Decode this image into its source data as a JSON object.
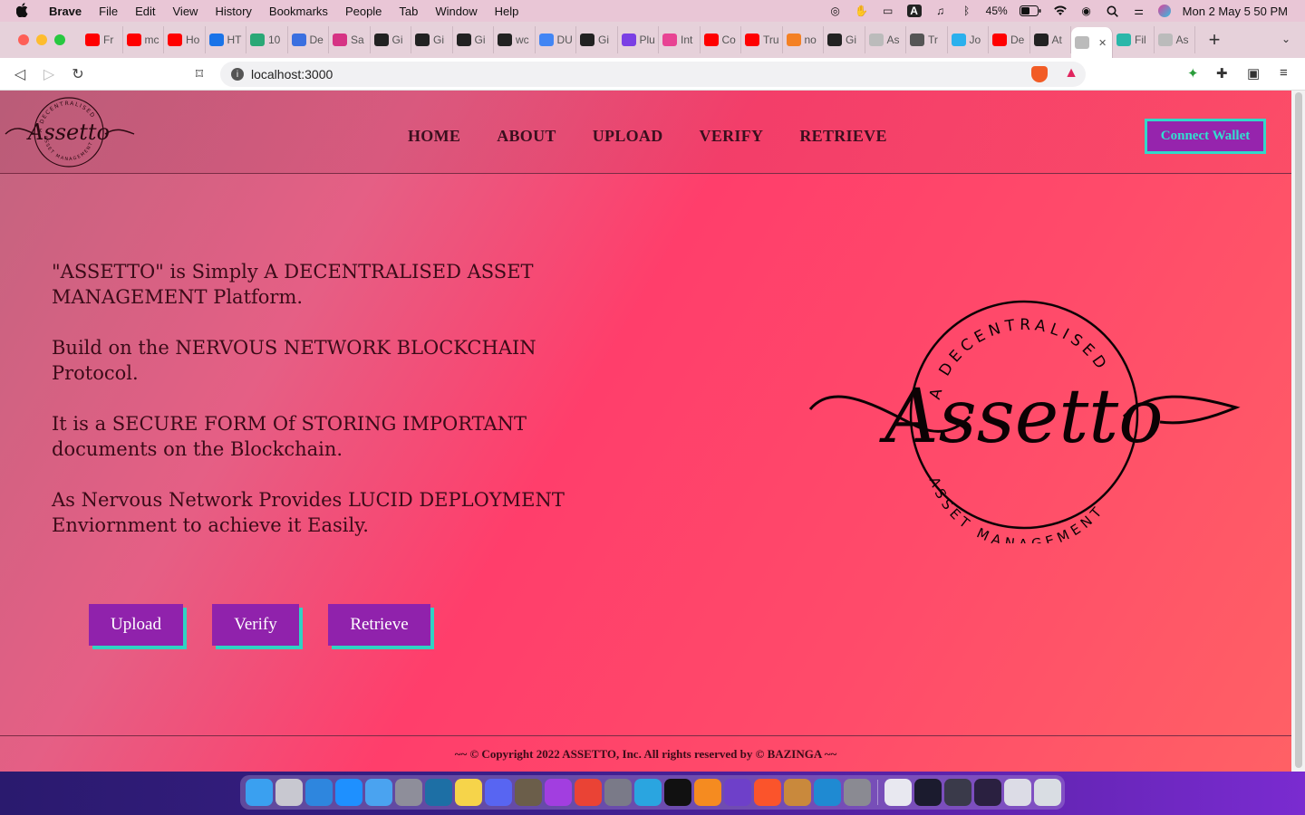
{
  "menubar": {
    "app_name": "Brave",
    "items": [
      "File",
      "Edit",
      "View",
      "History",
      "Bookmarks",
      "People",
      "Tab",
      "Window",
      "Help"
    ],
    "battery": "45%",
    "clock": "Mon 2 May  5 50 PM"
  },
  "tabs": [
    {
      "label": "Fr",
      "color": "#ff0000",
      "icon": "youtube-icon"
    },
    {
      "label": "mc",
      "color": "#ff0000",
      "icon": "youtube-icon"
    },
    {
      "label": "Ho",
      "color": "#ff0000",
      "icon": "youtube-icon"
    },
    {
      "label": "HT",
      "color": "#1a73e8",
      "icon": "site-icon"
    },
    {
      "label": "10",
      "color": "#2aa876",
      "icon": "site-icon"
    },
    {
      "label": "De",
      "color": "#3b6fe0",
      "icon": "site-icon"
    },
    {
      "label": "Sa",
      "color": "#d63384",
      "icon": "site-icon"
    },
    {
      "label": "Gi",
      "color": "#222222",
      "icon": "github-icon"
    },
    {
      "label": "Gi",
      "color": "#222222",
      "icon": "github-icon"
    },
    {
      "label": "Gi",
      "color": "#222222",
      "icon": "github-icon"
    },
    {
      "label": "wc",
      "color": "#222222",
      "icon": "github-icon"
    },
    {
      "label": "DU",
      "color": "#4285f4",
      "icon": "docs-icon"
    },
    {
      "label": "Gi",
      "color": "#222222",
      "icon": "github-icon"
    },
    {
      "label": "Plu",
      "color": "#7b3fe4",
      "icon": "site-icon"
    },
    {
      "label": "Int",
      "color": "#e84393",
      "icon": "site-icon"
    },
    {
      "label": "Co",
      "color": "#ff0000",
      "icon": "youtube-icon"
    },
    {
      "label": "Tru",
      "color": "#ff0000",
      "icon": "youtube-icon"
    },
    {
      "label": "no",
      "color": "#f48024",
      "icon": "stackoverflow-icon"
    },
    {
      "label": "Gi",
      "color": "#222222",
      "icon": "github-icon"
    },
    {
      "label": "As",
      "color": "#bbbbbb",
      "icon": "site-icon"
    },
    {
      "label": "Tr",
      "color": "#555555",
      "icon": "site-icon"
    },
    {
      "label": "Jo",
      "color": "#2bb0ed",
      "icon": "site-icon"
    },
    {
      "label": "De",
      "color": "#ff0000",
      "icon": "youtube-icon"
    },
    {
      "label": "At",
      "color": "#222222",
      "icon": "github-icon"
    },
    {
      "label": "",
      "color": "#bbbbbb",
      "icon": "site-icon",
      "active": true
    },
    {
      "label": "Fil",
      "color": "#2ab7a9",
      "icon": "site-icon"
    },
    {
      "label": "As",
      "color": "#bbbbbb",
      "icon": "site-icon"
    }
  ],
  "toolbar": {
    "url": "localhost:3000"
  },
  "site": {
    "nav": [
      "HOME",
      "ABOUT",
      "UPLOAD",
      "VERIFY",
      "RETRIEVE"
    ],
    "connect_label": "Connect Wallet",
    "logo": {
      "script": "Assetto",
      "top_arc": "A DECENTRALISED",
      "bottom_arc": "ASSET MANAGEMENT"
    },
    "paragraphs": [
      "\"ASSETTO\" is Simply A DECENTRALISED ASSET MANAGEMENT Platform.",
      "Build on the NERVOUS NETWORK BLOCKCHAIN Protocol.",
      "It is a SECURE FORM Of STORING IMPORTANT documents on the Blockchain.",
      "As Nervous Network Provides LUCID DEPLOYMENT Enviornment to achieve it Easily."
    ],
    "buttons": {
      "upload": "Upload",
      "verify": "Verify",
      "retrieve": "Retrieve"
    },
    "footer": "~~ © Copyright 2022 ASSETTO, Inc. All rights reserved by © BAZINGA ~~"
  },
  "colors": {
    "accent_purple": "#9022ac",
    "accent_teal": "#2fd3c3"
  },
  "dock": {
    "apps": [
      {
        "name": "finder",
        "color": "#3aa0f0"
      },
      {
        "name": "launchpad",
        "color": "#c8c8d0"
      },
      {
        "name": "safari",
        "color": "#2e86de"
      },
      {
        "name": "app-store",
        "color": "#1e90ff"
      },
      {
        "name": "mail",
        "color": "#4aa3f0"
      },
      {
        "name": "preview",
        "color": "#8e8e9a"
      },
      {
        "name": "mysql-workbench",
        "color": "#1d6fa5"
      },
      {
        "name": "notes",
        "color": "#f6d44a"
      },
      {
        "name": "discord",
        "color": "#5865f2"
      },
      {
        "name": "gimp",
        "color": "#6b5e4a"
      },
      {
        "name": "podcasts",
        "color": "#a23ee0"
      },
      {
        "name": "chrome",
        "color": "#ea4335"
      },
      {
        "name": "archive-utility",
        "color": "#7a7a88"
      },
      {
        "name": "telegram",
        "color": "#2aa5e0"
      },
      {
        "name": "terminal",
        "color": "#111111"
      },
      {
        "name": "sublime-text",
        "color": "#f58b20"
      },
      {
        "name": "github-desktop",
        "color": "#6e40c9"
      },
      {
        "name": "brave",
        "color": "#fb542b"
      },
      {
        "name": "box",
        "color": "#c9893c"
      },
      {
        "name": "vscode",
        "color": "#1f8ad2"
      },
      {
        "name": "system-preferences",
        "color": "#8a8a92"
      },
      {
        "name": "window-1",
        "color": "#e8e8f0"
      },
      {
        "name": "window-2",
        "color": "#1b1b2e"
      },
      {
        "name": "window-3",
        "color": "#3a3a4a"
      },
      {
        "name": "window-4",
        "color": "#2a2040"
      },
      {
        "name": "window-5",
        "color": "#dcdce6"
      },
      {
        "name": "trash",
        "color": "#d9dde3"
      }
    ]
  }
}
